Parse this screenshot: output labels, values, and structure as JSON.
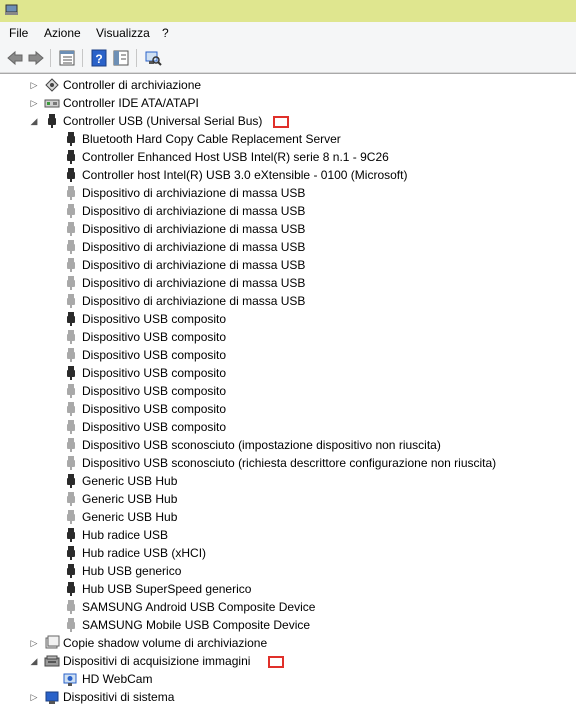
{
  "menu": [
    "File",
    "Azione",
    "Visualizza",
    "?"
  ],
  "toolbar": {
    "icons": [
      "back-arrow-icon",
      "forward-arrow-icon",
      "properties-grid-icon",
      "help-icon",
      "view-panel-icon",
      "scan-hardware-icon"
    ]
  },
  "tree": {
    "categories_top": [
      {
        "label": "Controller di archiviazione",
        "icon": "storage-controller-icon",
        "expanded": false
      },
      {
        "label": "Controller IDE ATA/ATAPI",
        "icon": "ide-controller-icon",
        "expanded": false
      },
      {
        "label": "Controller USB (Universal Serial Bus)",
        "icon": "usb-plug-icon",
        "expanded": true
      }
    ],
    "usb_devices": [
      {
        "label": "Bluetooth Hard Copy Cable Replacement Server",
        "state": "dark"
      },
      {
        "label": "Controller Enhanced Host USB Intel(R) serie 8 n.1 - 9C26",
        "state": "dark"
      },
      {
        "label": "Controller host Intel(R) USB 3.0 eXtensible - 0100 (Microsoft)",
        "state": "dark"
      },
      {
        "label": "Dispositivo di archiviazione di massa USB",
        "state": "light"
      },
      {
        "label": "Dispositivo di archiviazione di massa USB",
        "state": "light"
      },
      {
        "label": "Dispositivo di archiviazione di massa USB",
        "state": "light"
      },
      {
        "label": "Dispositivo di archiviazione di massa USB",
        "state": "light"
      },
      {
        "label": "Dispositivo di archiviazione di massa USB",
        "state": "light"
      },
      {
        "label": "Dispositivo di archiviazione di massa USB",
        "state": "light"
      },
      {
        "label": "Dispositivo di archiviazione di massa USB",
        "state": "light"
      },
      {
        "label": "Dispositivo USB composito",
        "state": "dark"
      },
      {
        "label": "Dispositivo USB composito",
        "state": "light"
      },
      {
        "label": "Dispositivo USB composito",
        "state": "light"
      },
      {
        "label": "Dispositivo USB composito",
        "state": "dark"
      },
      {
        "label": "Dispositivo USB composito",
        "state": "light"
      },
      {
        "label": "Dispositivo USB composito",
        "state": "light"
      },
      {
        "label": "Dispositivo USB composito",
        "state": "light"
      },
      {
        "label": "Dispositivo USB sconosciuto (impostazione dispositivo non riuscita)",
        "state": "light"
      },
      {
        "label": "Dispositivo USB sconosciuto (richiesta descrittore configurazione non riuscita)",
        "state": "light"
      },
      {
        "label": "Generic USB Hub",
        "state": "dark"
      },
      {
        "label": "Generic USB Hub",
        "state": "light"
      },
      {
        "label": "Generic USB Hub",
        "state": "light"
      },
      {
        "label": "Hub radice USB",
        "state": "dark"
      },
      {
        "label": "Hub radice USB (xHCI)",
        "state": "dark"
      },
      {
        "label": "Hub USB generico",
        "state": "dark"
      },
      {
        "label": "Hub USB SuperSpeed generico",
        "state": "dark"
      },
      {
        "label": "SAMSUNG Android USB Composite Device",
        "state": "light"
      },
      {
        "label": "SAMSUNG Mobile USB Composite Device",
        "state": "light"
      }
    ],
    "categories_bottom": [
      {
        "label": "Copie shadow volume di archiviazione",
        "icon": "shadow-copy-icon",
        "expanded": false
      },
      {
        "label": "Dispositivi di acquisizione immagini",
        "icon": "imaging-device-icon",
        "expanded": true
      }
    ],
    "imaging_devices": [
      {
        "label": "HD WebCam",
        "icon": "webcam-icon"
      }
    ],
    "categories_last": [
      {
        "label": "Dispositivi di sistema",
        "icon": "system-devices-icon",
        "expanded": false
      }
    ]
  },
  "colors": {
    "titlebar": "#dfe68f",
    "highlight_marker": "#e0302a",
    "plug_dark": "#2b2b2b",
    "plug_light": "#a9a9a9"
  }
}
